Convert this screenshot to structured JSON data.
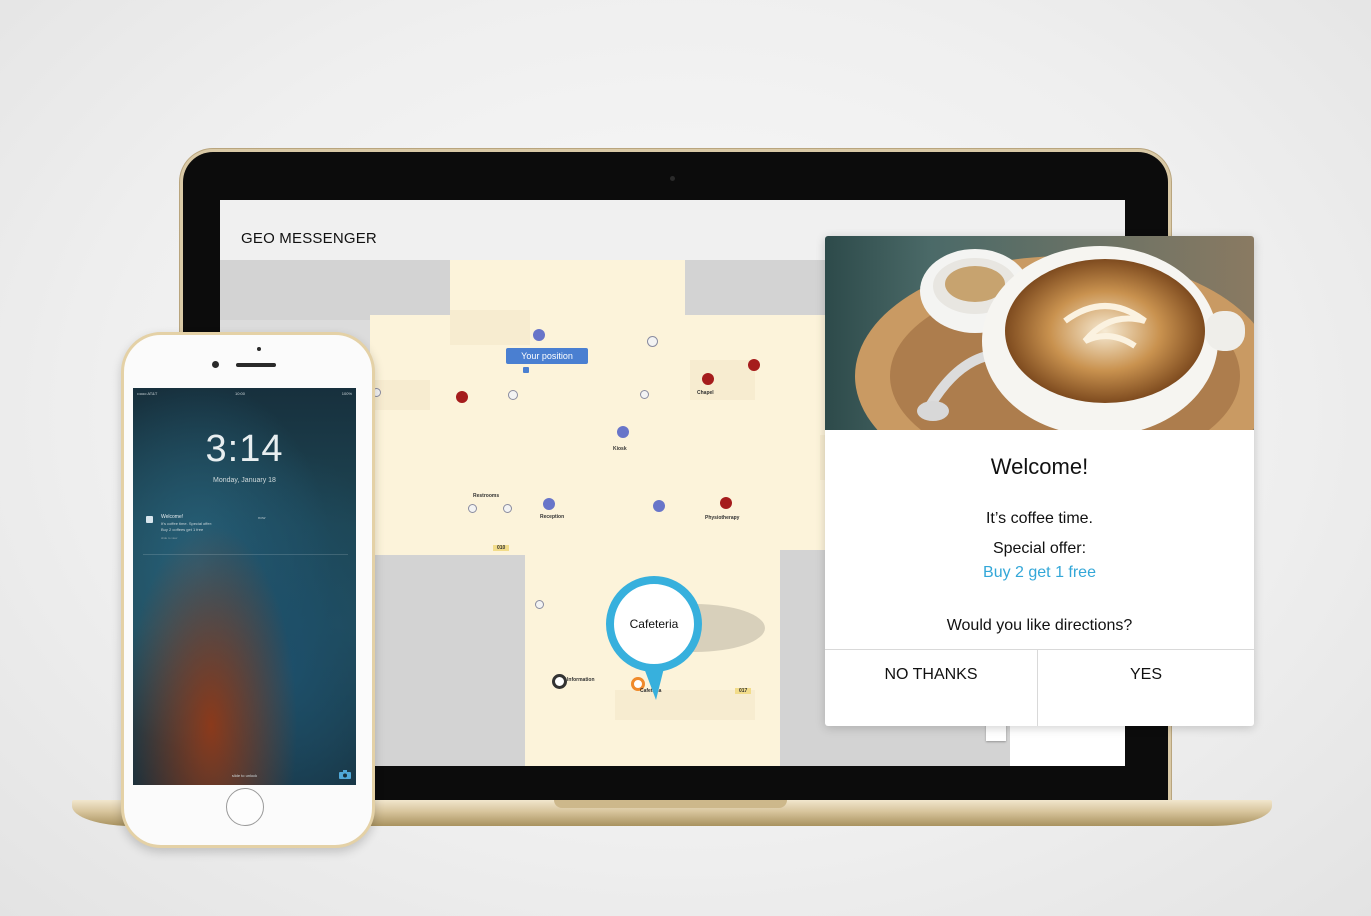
{
  "laptop": {
    "app_title": "GEO MESSENGER"
  },
  "map": {
    "your_position_label": "Your position",
    "labels": {
      "chapel": "Chapel",
      "kiosk": "Kiosk",
      "restrooms": "Restrooms",
      "reception": "Reception",
      "physiotherapy": "Physiotherapy",
      "information": "Information",
      "cafeteria_small": "Cafeteria",
      "room_010": "010",
      "room_017": "017"
    },
    "cafeteria_pin_label": "Cafeteria",
    "colors": {
      "pin_accent": "#37b0dd",
      "poi_blue": "#6875c9",
      "poi_red": "#a51c1c",
      "position_blue": "#4a7fd1"
    }
  },
  "popup": {
    "title": "Welcome!",
    "line1": "It’s coffee time.",
    "line2": "Special offer:",
    "offer": "Buy 2 get 1 free",
    "question": "Would you like directions?",
    "no_label": "NO THANKS",
    "yes_label": "YES",
    "offer_color": "#33a7d8"
  },
  "phone": {
    "status": {
      "carrier": "••ooo AT&T",
      "center": "10:00",
      "right": "100%"
    },
    "time": "3:14",
    "date": "Monday, January 18",
    "notification": {
      "title": "Welcome!",
      "time": "now",
      "line1": "It's coffee time. Special offer:",
      "line2": "Buy 2 coffees get 1 free",
      "hint": "slide to view"
    },
    "slide_text": "slide to unlock"
  }
}
